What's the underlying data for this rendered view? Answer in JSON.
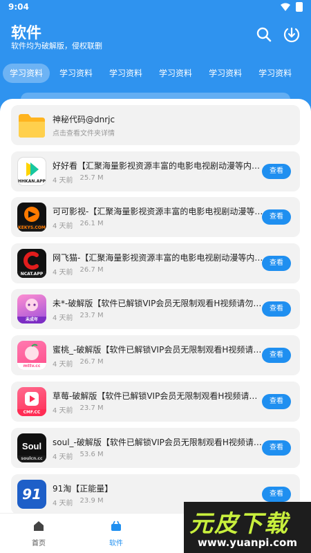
{
  "status": {
    "time": "9:04"
  },
  "header": {
    "title": "软件",
    "subtitle": "软件均为破解版，侵权联删"
  },
  "tabs": [
    "学习资料",
    "学习资料",
    "学习资料",
    "学习资料",
    "学习资料",
    "学习资料"
  ],
  "folder": {
    "title": "神秘代码@dnrjc",
    "subtitle": "点击查看文件夹详情"
  },
  "apps": [
    {
      "title": "好好看【汇聚海量影视资源丰富的电影电视剧动漫等内容…",
      "time": "4 天前",
      "size": "25.7 M",
      "button": "查看",
      "icon_label": "HHKAN.APP"
    },
    {
      "title": "可可影视-【汇聚海量影视资源丰富的电影电视剧动漫等…",
      "time": "4 天前",
      "size": "26.1 M",
      "button": "查看",
      "icon_label": "KEKYS.COM"
    },
    {
      "title": "网飞猫-【汇聚海量影视资源丰富的电影电视剧动漫等内…",
      "time": "4 天前",
      "size": "26.7 M",
      "button": "查看",
      "icon_label": "NCAT.APP"
    },
    {
      "title": "未*-破解版【软件已解锁VIP会员无限制观看H视频请勿…",
      "time": "4 天前",
      "size": "23.7 M",
      "button": "查看",
      "icon_label": "未成年"
    },
    {
      "title": "蜜桃_-破解版【软件已解锁VIP会员无限制观看H视频请…",
      "time": "4 天前",
      "size": "26.7 M",
      "button": "查看",
      "icon_label": "mttv.cc"
    },
    {
      "title": "草莓-破解版【软件已解锁VIP会员无限制观看H视频请勿…",
      "time": "4 天前",
      "size": "23.7 M",
      "button": "查看",
      "icon_label": "CMF.CC"
    },
    {
      "title": "soul_-破解版【软件已解锁VIP会员无限制观看H视频请…",
      "time": "4 天前",
      "size": "53.6 M",
      "button": "查看",
      "icon_label": "soulcn.cc"
    },
    {
      "title": "91淘【正能量】",
      "time": "4 天前",
      "size": "23.9 M",
      "button": "查看",
      "icon_label": "91"
    }
  ],
  "nav": {
    "home": "首页",
    "software": "软件"
  },
  "watermark": {
    "main": "元皮下载",
    "url": "www.yuanpi.com"
  },
  "colors": {
    "primary": "#2f93ef",
    "button": "#1f8ff0",
    "card": "#f2f2f2",
    "folder": "#ffc53d"
  }
}
